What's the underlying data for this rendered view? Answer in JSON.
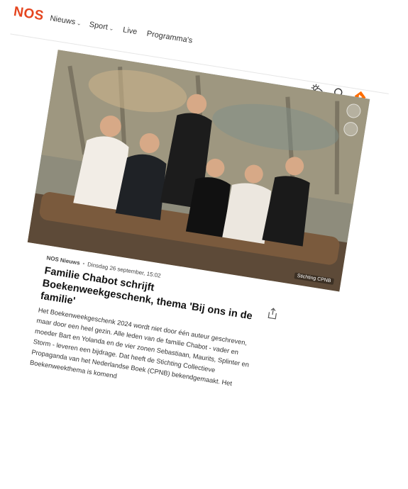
{
  "header": {
    "logo": "NOS",
    "nav": [
      {
        "label": "Nieuws",
        "has_dropdown": true
      },
      {
        "label": "Sport",
        "has_dropdown": true
      },
      {
        "label": "Live",
        "has_dropdown": false
      },
      {
        "label": "Programma's",
        "has_dropdown": false
      }
    ],
    "icons": [
      "weather-icon",
      "search-icon",
      "npo-icon"
    ]
  },
  "article": {
    "photo_credit": "Stichting CPNB",
    "source": "NOS Nieuws",
    "date": "Dinsdag 26 september, 15:02",
    "title": "Familie Chabot schrijft Boekenweekgeschenk, thema 'Bij ons in de familie'",
    "body": "Het Boekenweekgeschenk 2024 wordt niet door één auteur geschreven, maar door een heel gezin. Alle leden van de familie Chabot - vader en moeder Bart en Yolanda en de vier zonen Sebastiaan, Maurits, Splinter en Storm - leveren een bijdrage. Dat heeft de Stichting Collectieve Propaganda van het Nederlandse Boek (CPNB) bekendgemaakt. Het Boekenweekthema is komend"
  },
  "colors": {
    "brand": "#e5451f",
    "text": "#111111"
  }
}
